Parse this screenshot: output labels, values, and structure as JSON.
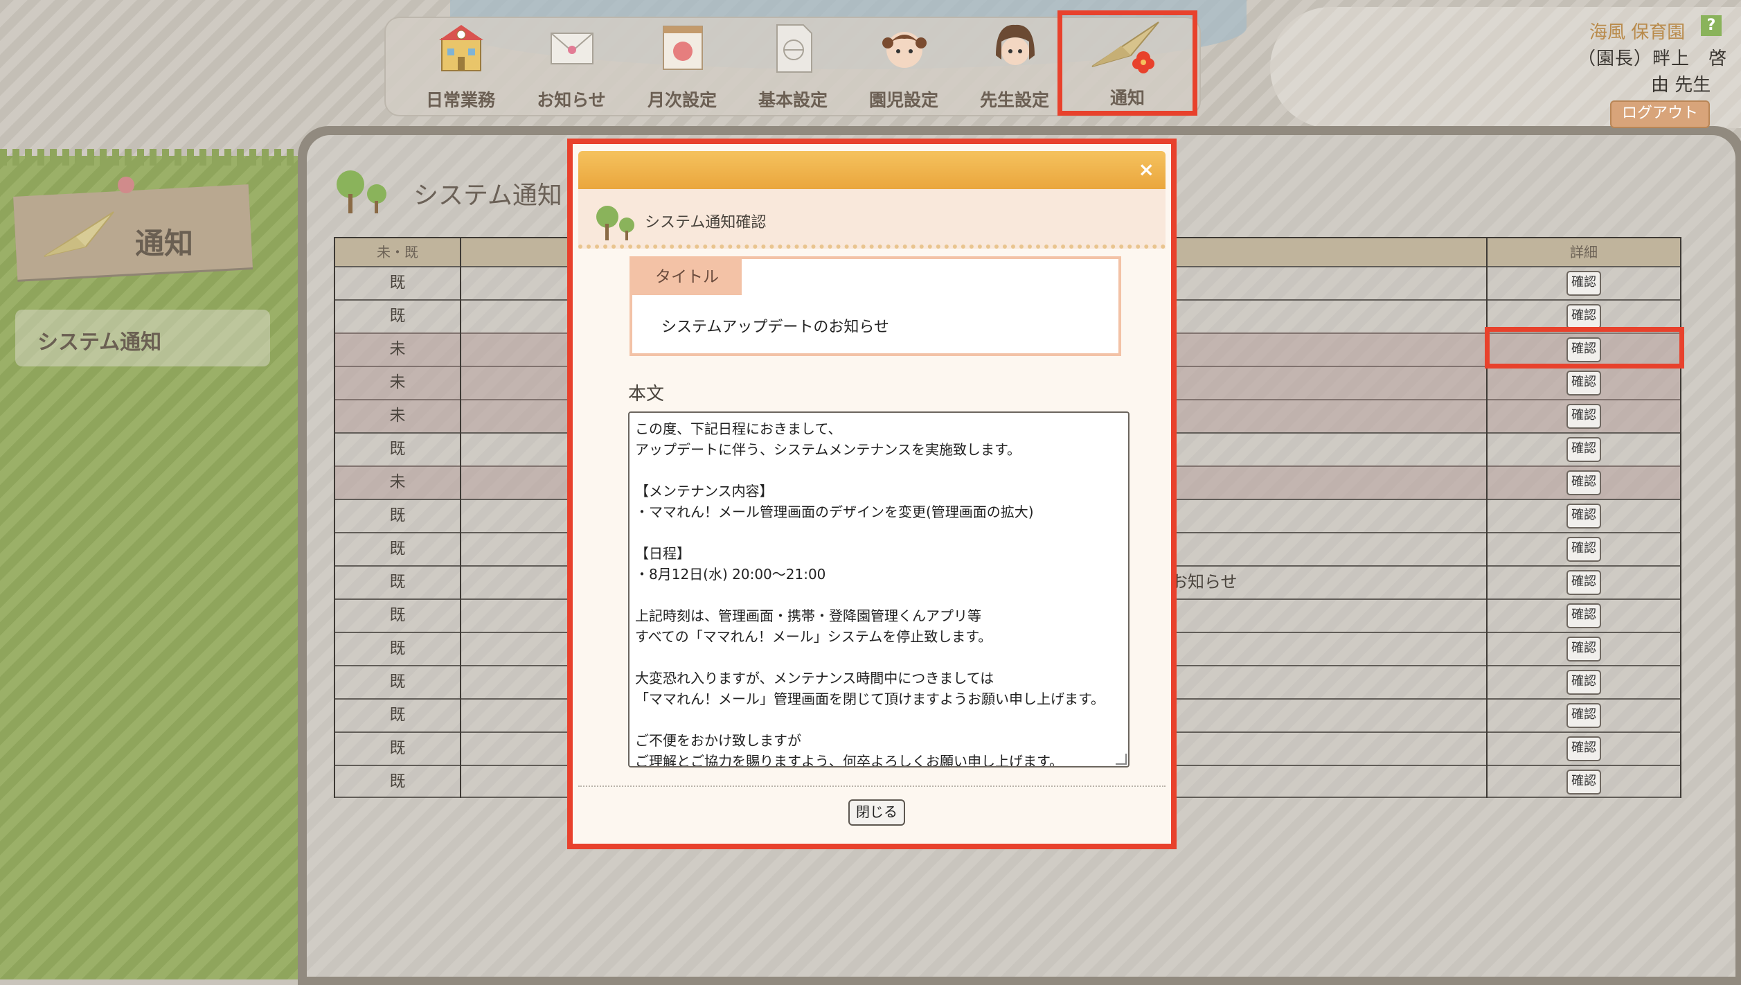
{
  "nav": {
    "items": [
      {
        "label": "日常業務",
        "icon": "school-building-icon"
      },
      {
        "label": "お知らせ",
        "icon": "envelope-icon"
      },
      {
        "label": "月次設定",
        "icon": "calendar-icon"
      },
      {
        "label": "基本設定",
        "icon": "document-icon"
      },
      {
        "label": "園児設定",
        "icon": "child-face-icon"
      },
      {
        "label": "先生設定",
        "icon": "teacher-face-icon"
      },
      {
        "label": "通知",
        "icon": "paper-plane-icon"
      }
    ]
  },
  "user": {
    "org": "海風 保育園",
    "name": "（園長）畔上　啓",
    "name2": "由 先生",
    "help": "?",
    "logout": "ログアウト"
  },
  "sidebar": {
    "card_title": "通知",
    "items": [
      {
        "label": "システム通知"
      }
    ]
  },
  "page": {
    "title": "システム通知"
  },
  "table": {
    "header_status": "未・既",
    "header_detail": "詳細",
    "confirm_label": "確認",
    "rows": [
      {
        "status": "既",
        "subject": ""
      },
      {
        "status": "既",
        "subject": ""
      },
      {
        "status": "未",
        "subject": ""
      },
      {
        "status": "未",
        "subject": ""
      },
      {
        "status": "未",
        "subject": ""
      },
      {
        "status": "既",
        "subject": ""
      },
      {
        "status": "未",
        "subject": ""
      },
      {
        "status": "既",
        "subject": ""
      },
      {
        "status": "既",
        "subject": ""
      },
      {
        "status": "既",
        "subject": "お知らせ"
      },
      {
        "status": "既",
        "subject": ""
      },
      {
        "status": "既",
        "subject": ""
      },
      {
        "status": "既",
        "subject": ""
      },
      {
        "status": "既",
        "subject": ""
      },
      {
        "status": "既",
        "subject": ""
      },
      {
        "status": "既",
        "subject": ""
      }
    ]
  },
  "dialog": {
    "close": "×",
    "header": "システム通知確認",
    "title_label": "タイトル",
    "title_value": "システムアップデートのお知らせ",
    "body_label": "本文",
    "body_lines": [
      "この度、下記日程におきまして、",
      "アップデートに伴う、システムメンテナンスを実施致します。",
      "",
      "【メンテナンス内容】",
      "・ママれん！メール管理画面のデザインを変更(管理画面の拡大)",
      "",
      "【日程】",
      "・8月12日(水) 20:00〜21:00",
      "",
      "上記時刻は、管理画面・携帯・登降園管理くんアプリ等",
      "すべての「ママれん！メール」システムを停止致します。",
      "",
      "大変恐れ入りますが、メンテナンス時間中につきましては",
      "「ママれん！メール」管理画面を閉じて頂けますようお願い申し上げます。",
      "",
      "ご不便をおかけ致しますが",
      "ご理解とご協力を賜りますよう、何卒よろしくお願い申し上げます。"
    ],
    "close_button": "閉じる"
  },
  "colors": {
    "highlight": "#e8412c",
    "header_orange": "#eaa63d",
    "title_tag": "#f3c2a6"
  }
}
